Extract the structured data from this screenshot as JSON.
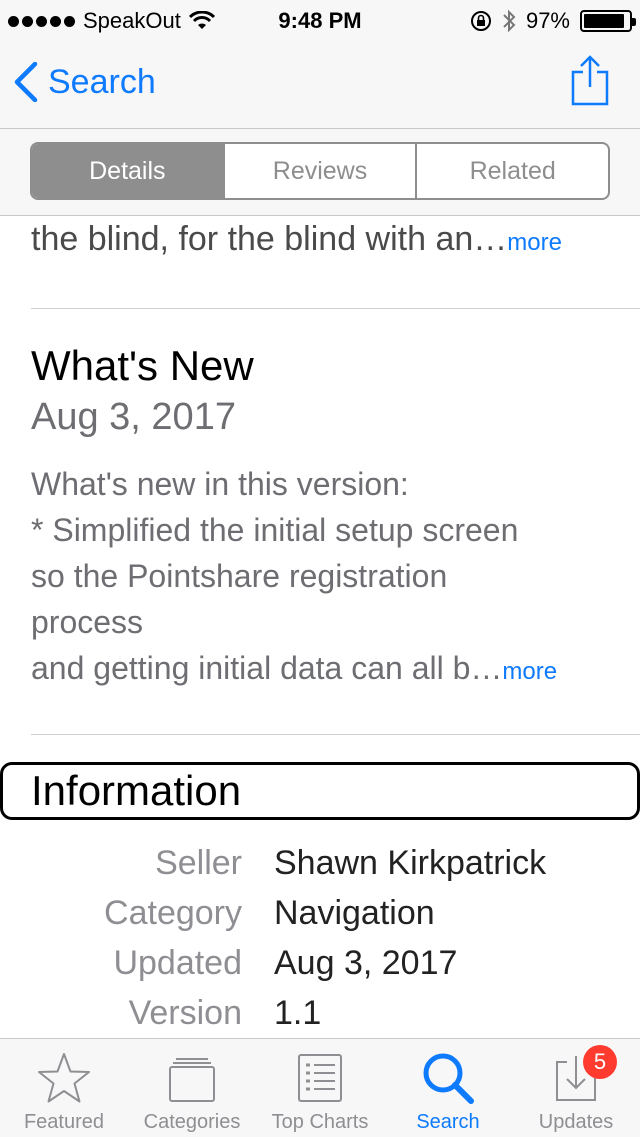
{
  "status_bar": {
    "carrier": "SpeakOut",
    "time": "9:48 PM",
    "battery": "97%"
  },
  "nav": {
    "back_label": "Search"
  },
  "segments": [
    {
      "label": "Details",
      "active": true
    },
    {
      "label": "Reviews",
      "active": false
    },
    {
      "label": "Related",
      "active": false
    }
  ],
  "description": {
    "snippet": "the blind, for the blind with an…",
    "more": "more"
  },
  "whats_new": {
    "title": "What's New",
    "date": "Aug 3, 2017",
    "lines": [
      "What's new in this version:",
      "* Simplified the initial setup screen",
      "so the Pointshare registration",
      "process",
      "and getting initial data can all b…"
    ],
    "more": "more"
  },
  "information": {
    "title": "Information",
    "rows": [
      {
        "label": "Seller",
        "value": "Shawn Kirkpatrick"
      },
      {
        "label": "Category",
        "value": "Navigation"
      },
      {
        "label": "Updated",
        "value": "Aug 3, 2017"
      },
      {
        "label": "Version",
        "value": "1.1"
      }
    ]
  },
  "tabs": [
    {
      "label": "Featured",
      "icon": "star-icon"
    },
    {
      "label": "Categories",
      "icon": "categories-icon"
    },
    {
      "label": "Top Charts",
      "icon": "top-charts-icon"
    },
    {
      "label": "Search",
      "icon": "search-icon",
      "active": true
    },
    {
      "label": "Updates",
      "icon": "updates-icon",
      "badge": "5"
    }
  ],
  "colors": {
    "accent": "#0e7afe",
    "badge": "#ff3b30",
    "segment": "#8e8e8e"
  }
}
